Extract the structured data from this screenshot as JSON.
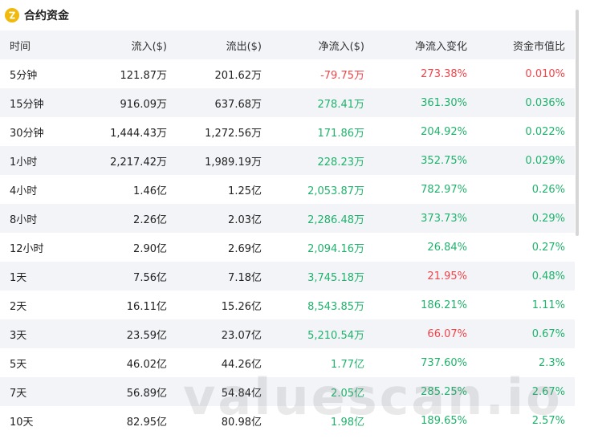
{
  "header": {
    "title": "合约资金",
    "icon": "coin-logo-icon",
    "accent": "#f0b90b"
  },
  "colors": {
    "positive": "#20b26c",
    "negative": "#ef454a"
  },
  "columns": [
    "时间",
    "流入($)",
    "流出($)",
    "净流入($)",
    "净流入变化",
    "资金市值比"
  ],
  "rows": [
    [
      "5分钟",
      "121.87万",
      "201.62万",
      "-79.75万",
      "273.38%",
      "0.010%"
    ],
    [
      "15分钟",
      "916.09万",
      "637.68万",
      "278.41万",
      "361.30%",
      "0.036%"
    ],
    [
      "30分钟",
      "1,444.43万",
      "1,272.56万",
      "171.86万",
      "204.92%",
      "0.022%"
    ],
    [
      "1小时",
      "2,217.42万",
      "1,989.19万",
      "228.23万",
      "352.75%",
      "0.029%"
    ],
    [
      "4小时",
      "1.46亿",
      "1.25亿",
      "2,053.87万",
      "782.97%",
      "0.26%"
    ],
    [
      "8小时",
      "2.26亿",
      "2.03亿",
      "2,286.48万",
      "373.73%",
      "0.29%"
    ],
    [
      "12小时",
      "2.90亿",
      "2.69亿",
      "2,094.16万",
      "26.84%",
      "0.27%"
    ],
    [
      "1天",
      "7.56亿",
      "7.18亿",
      "3,745.18万",
      "21.95%",
      "0.48%"
    ],
    [
      "2天",
      "16.11亿",
      "15.26亿",
      "8,543.85万",
      "186.21%",
      "1.11%"
    ],
    [
      "3天",
      "23.59亿",
      "23.07亿",
      "5,210.54万",
      "66.07%",
      "0.67%"
    ],
    [
      "5天",
      "46.02亿",
      "44.26亿",
      "1.77亿",
      "737.60%",
      "2.3%"
    ],
    [
      "7天",
      "56.89亿",
      "54.84亿",
      "2.05亿",
      "285.25%",
      "2.67%"
    ],
    [
      "10天",
      "82.95亿",
      "80.98亿",
      "1.98亿",
      "189.65%",
      "2.57%"
    ]
  ],
  "cell_colors": [
    [
      "",
      "",
      "",
      "red",
      "red",
      "red"
    ],
    [
      "",
      "",
      "",
      "green",
      "green",
      "green"
    ],
    [
      "",
      "",
      "",
      "green",
      "green",
      "green"
    ],
    [
      "",
      "",
      "",
      "green",
      "green",
      "green"
    ],
    [
      "",
      "",
      "",
      "green",
      "green",
      "green"
    ],
    [
      "",
      "",
      "",
      "green",
      "green",
      "green"
    ],
    [
      "",
      "",
      "",
      "green",
      "green",
      "green"
    ],
    [
      "",
      "",
      "",
      "green",
      "red",
      "green"
    ],
    [
      "",
      "",
      "",
      "green",
      "green",
      "green"
    ],
    [
      "",
      "",
      "",
      "green",
      "red",
      "green"
    ],
    [
      "",
      "",
      "",
      "green",
      "green",
      "green"
    ],
    [
      "",
      "",
      "",
      "green",
      "green",
      "green"
    ],
    [
      "",
      "",
      "",
      "green",
      "green",
      "green"
    ]
  ],
  "watermark": "valuescan.io"
}
